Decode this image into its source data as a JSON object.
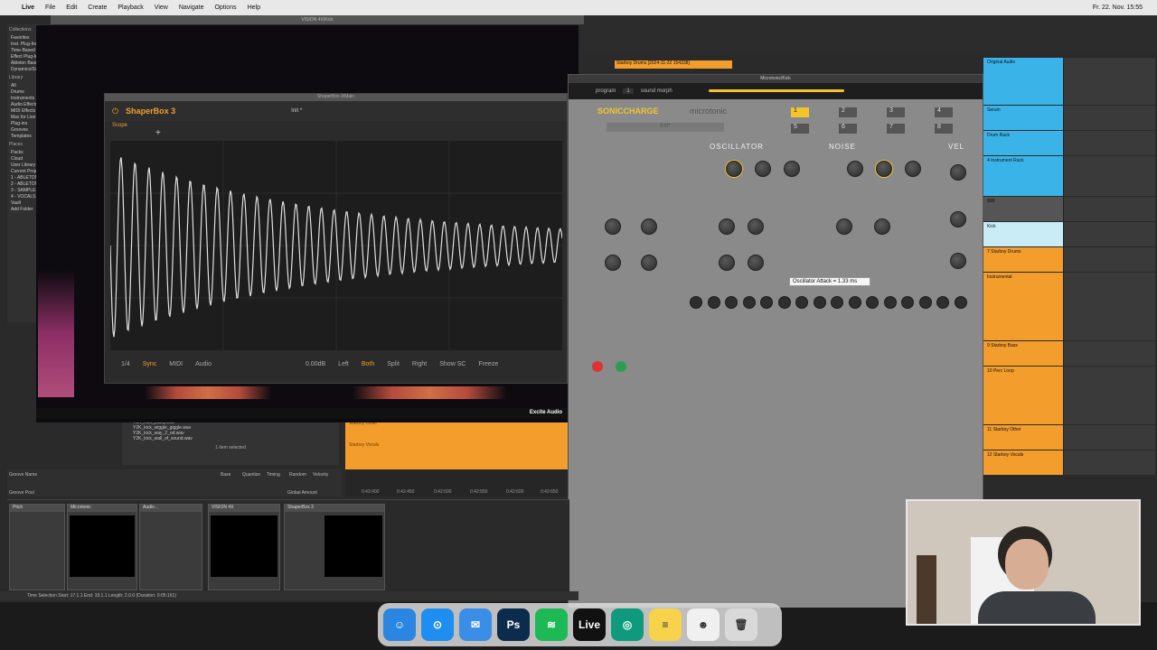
{
  "menubar": {
    "app": "Live",
    "items": [
      "File",
      "Edit",
      "Create",
      "Playback",
      "View",
      "Navigate",
      "Options",
      "Help"
    ],
    "clock": "Fr. 22. Nov. 15:55"
  },
  "vision": {
    "title": "VISION 4X/Kick",
    "brand": "Excite Audio"
  },
  "browser": {
    "collections_label": "Collections",
    "collections": [
      "Favorites",
      "Inst. Plug-Ins",
      "Time-Based",
      "Effect Plug-Ins",
      "Ableton Basics",
      "Dynamics/Si"
    ],
    "library_label": "Library",
    "library": [
      "All",
      "Drums",
      "Instruments",
      "Audio Effects",
      "MIDI Effects",
      "Max for Live",
      "Plug-ins",
      "Grooves",
      "Templates"
    ],
    "places_label": "Places",
    "places": [
      "Packs",
      "Cloud",
      "User Library",
      "Current Project",
      "1 - ABLETON",
      "2 - ABLETON",
      "3 - SAMPLES",
      "4 - VOCALS",
      "Vault",
      "Add Folder"
    ],
    "files": [
      "Y2K_kick_yucky.wav",
      "Y2K_kick_wiggle_giggle.wav",
      "Y2K_kick_way_2_od.wav",
      "Y2K_kick_wall_of_sound.wav"
    ],
    "selected": "1 item selected"
  },
  "shaperbox": {
    "window_title": "ShaperBox 3/Main",
    "logo": "ShaperBox 3",
    "preset": "Init *",
    "tab": "Scope",
    "footer": {
      "division": "1/4",
      "sync": "Sync",
      "midi": "MIDI",
      "audio": "Audio",
      "gain": "0.00dB",
      "left": "Left",
      "both": "Both",
      "split": "Split",
      "right": "Right",
      "showsc": "Show SC",
      "freeze": "Freeze"
    }
  },
  "microtonic": {
    "window_title": "Microtonic/Kick",
    "program_label": "program",
    "program": "1",
    "morph_label": "sound morph",
    "brand": "SONICCHARGE",
    "product": "microtonic",
    "patch": "Init*",
    "sections": [
      "OSCILLATOR",
      "NOISE",
      "VEL"
    ],
    "tooltip": "Oscillator Attack = 1.33 ms",
    "patterns": [
      "1",
      "2",
      "3",
      "4",
      "5",
      "6",
      "7",
      "8"
    ]
  },
  "tracks": [
    {
      "name": "Original Audio",
      "color": "#3ab4e8"
    },
    {
      "name": "Serum",
      "color": "#3ab4e8"
    },
    {
      "name": "Drum Rack",
      "color": "#3ab4e8"
    },
    {
      "name": "4 Instrument Rack",
      "color": "#3ab4e8"
    },
    {
      "name": "808",
      "color": "#555555"
    },
    {
      "name": "Kick",
      "color": "#c9ecf7"
    },
    {
      "name": "7 Starboy Drums",
      "color": "#f39d2c"
    },
    {
      "name": "Instrumental",
      "color": "#f39d2c"
    },
    {
      "name": "9 Starboy Bass",
      "color": "#f39d2c"
    },
    {
      "name": "10 Perc Loop",
      "color": "#f39d2c"
    },
    {
      "name": "11 Starboy Other",
      "color": "#f39d2c"
    },
    {
      "name": "12 Starboy Vocals",
      "color": "#f39d2c"
    }
  ],
  "arrangement": {
    "clip": "Starboy Drums [2024-11-22 154338]",
    "clips_low": [
      "Starboy Other",
      "Starboy Vocals"
    ],
    "timecodes": [
      "0:42:400",
      "0:42:450",
      "0:42:500",
      "0:42:550",
      "0:42:600",
      "0:42:650"
    ]
  },
  "devices": [
    {
      "name": "Pitch"
    },
    {
      "name": "Microtonic"
    },
    {
      "name": "Audio..."
    },
    {
      "name": "VISION 4X"
    },
    {
      "name": "ShaperBox 3"
    }
  ],
  "groove": {
    "label": "Groove Name",
    "cols": [
      "Base",
      "Quantize",
      "Timing",
      "Random",
      "Velocity"
    ],
    "pool": "Groove Pool",
    "global": "Global Amount"
  },
  "status": "Time Selection  Start: 17.1.1  End: 19.1.1  Length: 2.0.0 (Duration: 0:05:161)",
  "dock": [
    {
      "name": "Finder",
      "color": "#2a86e0",
      "glyph": "☺"
    },
    {
      "name": "Safari",
      "color": "#1f8ef1",
      "glyph": "⊙"
    },
    {
      "name": "Mail",
      "color": "#3a8ee6",
      "glyph": "✉"
    },
    {
      "name": "Ps",
      "color": "#0c2c4d",
      "glyph": "Ps"
    },
    {
      "name": "Spotify",
      "color": "#1db954",
      "glyph": "≋"
    },
    {
      "name": "Live",
      "color": "#111111",
      "glyph": "Live"
    },
    {
      "name": "ChatGPT",
      "color": "#0f9a7e",
      "glyph": "◎"
    },
    {
      "name": "Notes",
      "color": "#f6d34a",
      "glyph": "≡"
    },
    {
      "name": "Discord",
      "color": "#f0f0f0",
      "glyph": "☻"
    },
    {
      "name": "Trash",
      "color": "#d9d9d9",
      "glyph": "🗑"
    }
  ]
}
